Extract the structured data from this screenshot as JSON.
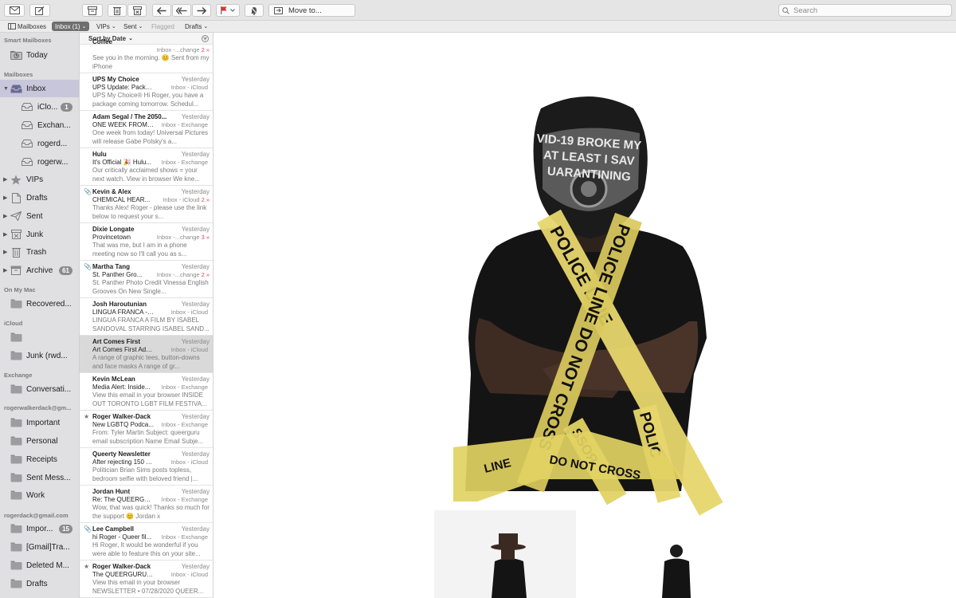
{
  "toolbar": {
    "move_to_label": "Move to...",
    "search_placeholder": "Search"
  },
  "favorites": {
    "mailboxes": "Mailboxes",
    "inbox": "Inbox (1)",
    "vips": "VIPs",
    "sent": "Sent",
    "flagged": "Flagged",
    "drafts": "Drafts"
  },
  "sidebar": {
    "smart_mailboxes": "Smart Mailboxes",
    "today": "Today",
    "mailboxes_header": "Mailboxes",
    "inbox": "Inbox",
    "inbox_accounts": [
      {
        "label": "iClo...",
        "badge": "1"
      },
      {
        "label": "Exchan..."
      },
      {
        "label": "rogerd..."
      },
      {
        "label": "rogerw..."
      }
    ],
    "vips": "VIPs",
    "drafts": "Drafts",
    "sent": "Sent",
    "junk": "Junk",
    "trash": "Trash",
    "archive": "Archive",
    "archive_badge": "61",
    "on_my_mac": "On My Mac",
    "recovered": "Recovered...",
    "icloud_header": "iCloud",
    "icloud_blank": "",
    "icloud_junk": "Junk (rwd...",
    "exchange_header": "Exchange",
    "conversation": "Conversati...",
    "account1_header": "rogerwalkerdack@gm...",
    "important": "Important",
    "personal": "Personal",
    "receipts": "Receipts",
    "sent_messages": "Sent Mess...",
    "work": "Work",
    "account2_header": "rogerdack@gmail.com",
    "important2": "Impor...",
    "important2_badge": "15",
    "gmail_trash": "[Gmail]Tra...",
    "deleted": "Deleted M...",
    "drafts2": "Drafts"
  },
  "list": {
    "sort_label": "Sort by Date",
    "messages": [
      {
        "from": "Coffee",
        "date": "",
        "subject": "",
        "mailbox": "Inbox -...change",
        "thread": "2 »",
        "preview": "See you in the morning. 😊 Sent from my iPhone"
      },
      {
        "from": "UPS My Choice",
        "date": "Yesterday",
        "subject": "UPS Update: Package...",
        "mailbox": "Inbox - iCloud",
        "thread": "",
        "preview": "UPS My Choice® Hi Roger, you have a package coming tomorrow. Schedul..."
      },
      {
        "from": "Adam Segal / The 2050...",
        "date": "Yesterday",
        "subject": "ONE WEEK FROM T...",
        "mailbox": "Inbox - Exchange",
        "thread": "",
        "preview": "One week from today! Universal Pictures will release Gabe Polsky's a..."
      },
      {
        "from": "Hulu",
        "date": "Yesterday",
        "subject": "It's Official 🎉 Hulu...",
        "mailbox": "Inbox - Exchange",
        "thread": "",
        "preview": "Our critically acclaimed shows = your next watch. View in browser We kne..."
      },
      {
        "from": "Kevin & Alex",
        "date": "Yesterday",
        "subject": "CHEMICAL HEAR...",
        "mailbox": "Inbox - iCloud",
        "thread": "2 »",
        "preview": "Thanks Alex! Roger - please use the link below to request your s...",
        "clip": true
      },
      {
        "from": "Dixie Longate",
        "date": "Yesterday",
        "subject": "Provincetown",
        "mailbox": "Inbox -...change",
        "thread": "3 »",
        "preview": "That was me, but I am in a phone meeting now so I'll call you as s..."
      },
      {
        "from": "Martha Tang",
        "date": "Yesterday",
        "subject": "St. Panther Gro...",
        "mailbox": "Inbox -...change",
        "thread": "2 »",
        "preview": "St. Panther Photo Credit Vinessa English Grooves On New Single...",
        "clip": true
      },
      {
        "from": "Josh Haroutunian",
        "date": "Yesterday",
        "subject": "LINGUA FRANCA - Isa...",
        "mailbox": "Inbox - iCloud",
        "thread": "",
        "preview": "LINGUA FRANCA A FILM BY ISABEL SANDOVAL STARRING ISABEL SAND..."
      },
      {
        "from": "Art Comes First",
        "date": "Yesterday",
        "subject": "Art Comes First Addre...",
        "mailbox": "Inbox - iCloud",
        "thread": "",
        "preview": "A range of graphic tees, button-downs and face masks A range of gr...",
        "selected": true
      },
      {
        "from": "Kevin McLean",
        "date": "Yesterday",
        "subject": "Media Alert: Inside...",
        "mailbox": "Inbox - Exchange",
        "thread": "",
        "preview": "View this email in your browser INSIDE OUT TORONTO LGBT FILM FESTIVA..."
      },
      {
        "from": "Roger Walker-Dack",
        "date": "Yesterday",
        "subject": "New LGBTQ Podca...",
        "mailbox": "Inbox - Exchange",
        "thread": "",
        "preview": "From: Tyler Martin Subject: queerguru email subscription Name Email Subje...",
        "star": true
      },
      {
        "from": "Queerty Newsletter",
        "date": "Yesterday",
        "subject": "After rejecting 150 wo...",
        "mailbox": "Inbox - iCloud",
        "thread": "",
        "preview": "Politician Brian Sims posts topless, bedroom selfie with beloved friend |..."
      },
      {
        "from": "Jordan Hunt",
        "date": "Yesterday",
        "subject": "Re: The QUEERGUR...",
        "mailbox": "Inbox - Exchange",
        "thread": "",
        "preview": "Wow, that was quick! Thanks so much for the support 😊 Jordan x"
      },
      {
        "from": "Lee Campbell",
        "date": "Yesterday",
        "subject": "hi Roger - Queer fil...",
        "mailbox": "Inbox - Exchange",
        "thread": "",
        "preview": "Hi Roger, It would be wonderful if you were able to feature this on your site...",
        "clip": true
      },
      {
        "from": "Roger Walker-Dack",
        "date": "Yesterday",
        "subject": "The QUEERGURU New...",
        "mailbox": "Inbox - iCloud",
        "thread": "",
        "preview": "View this email in your browser NEWSLETTER • 07/28/2020 QUEER...",
        "star": true
      }
    ]
  },
  "reader": {
    "mask_line1": "VID-19 BROKE MY",
    "mask_line2": "AT LEAST I SAV",
    "mask_line3": "UARANTINING",
    "tape1": "POLICE LINE",
    "tape2": "POLICE LINE DO NOT CROSS",
    "tape3": "DO NOT CROSS",
    "tape4": "POLIC",
    "tape5": "SSOЯ",
    "tape6": "LINE"
  }
}
